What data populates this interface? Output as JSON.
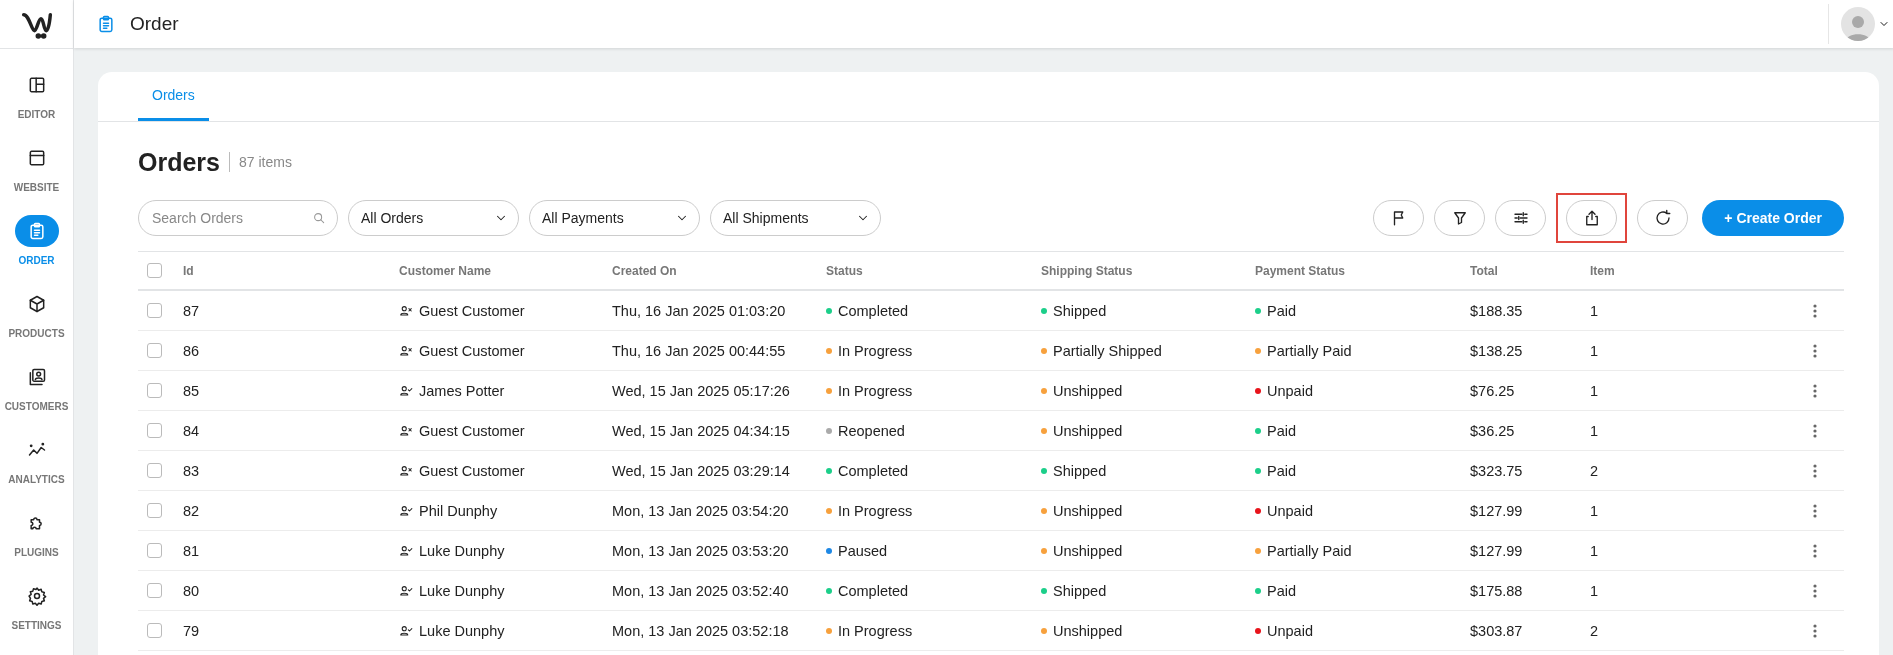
{
  "sidebar": {
    "items": [
      {
        "label": "EDITOR",
        "selected": false
      },
      {
        "label": "WEBSITE",
        "selected": false
      },
      {
        "label": "ORDER",
        "selected": true
      },
      {
        "label": "PRODUCTS",
        "selected": false
      },
      {
        "label": "CUSTOMERS",
        "selected": false
      },
      {
        "label": "ANALYTICS",
        "selected": false
      },
      {
        "label": "PLUGINS",
        "selected": false
      },
      {
        "label": "SETTINGS",
        "selected": false
      }
    ]
  },
  "header": {
    "title": "Order"
  },
  "tabs": [
    {
      "label": "Orders",
      "selected": true
    }
  ],
  "page": {
    "title": "Orders",
    "count": "87 items"
  },
  "search": {
    "placeholder": "Search Orders"
  },
  "filters": [
    {
      "value": "All Orders"
    },
    {
      "value": "All Payments"
    },
    {
      "value": "All Shipments"
    }
  ],
  "toolbar_buttons": [
    {
      "kind": "flag",
      "highlighted": false
    },
    {
      "kind": "filter",
      "highlighted": false
    },
    {
      "kind": "sliders",
      "highlighted": false
    },
    {
      "kind": "export",
      "highlighted": true
    },
    {
      "kind": "refresh",
      "highlighted": false
    }
  ],
  "create_button": "+ Create Order",
  "table": {
    "columns": [
      "Id",
      "Customer Name",
      "Created On",
      "Status",
      "Shipping Status",
      "Payment Status",
      "Total",
      "Item"
    ],
    "header_checked": false,
    "rows": [
      {
        "checked": false,
        "id": "87",
        "customer": "Guest Customer",
        "kind": "guest",
        "created": "Thu, 16 Jan 2025 01:03:20",
        "status": {
          "text": "Completed",
          "color": "#1ccf8a"
        },
        "shipping": {
          "text": "Shipped",
          "color": "#1ccf8a"
        },
        "payment": {
          "text": "Paid",
          "color": "#1ccf8a"
        },
        "total": "$188.35",
        "item": "1"
      },
      {
        "checked": false,
        "id": "86",
        "customer": "Guest Customer",
        "kind": "guest",
        "created": "Thu, 16 Jan 2025 00:44:55",
        "status": {
          "text": "In Progress",
          "color": "#f7a13d"
        },
        "shipping": {
          "text": "Partially Shipped",
          "color": "#f7a13d"
        },
        "payment": {
          "text": "Partially Paid",
          "color": "#f7a13d"
        },
        "total": "$138.25",
        "item": "1"
      },
      {
        "checked": false,
        "id": "85",
        "customer": "James Potter",
        "kind": "registered",
        "created": "Wed, 15 Jan 2025 05:17:26",
        "status": {
          "text": "In Progress",
          "color": "#f7a13d"
        },
        "shipping": {
          "text": "Unshipped",
          "color": "#f7a13d"
        },
        "payment": {
          "text": "Unpaid",
          "color": "#e8141b"
        },
        "total": "$76.25",
        "item": "1"
      },
      {
        "checked": false,
        "id": "84",
        "customer": "Guest Customer",
        "kind": "guest",
        "created": "Wed, 15 Jan 2025 04:34:15",
        "status": {
          "text": "Reopened",
          "color": "#aaaaaa"
        },
        "shipping": {
          "text": "Unshipped",
          "color": "#f7a13d"
        },
        "payment": {
          "text": "Paid",
          "color": "#1ccf8a"
        },
        "total": "$36.25",
        "item": "1"
      },
      {
        "checked": false,
        "id": "83",
        "customer": "Guest Customer",
        "kind": "guest",
        "created": "Wed, 15 Jan 2025 03:29:14",
        "status": {
          "text": "Completed",
          "color": "#1ccf8a"
        },
        "shipping": {
          "text": "Shipped",
          "color": "#1ccf8a"
        },
        "payment": {
          "text": "Paid",
          "color": "#1ccf8a"
        },
        "total": "$323.75",
        "item": "2"
      },
      {
        "checked": false,
        "id": "82",
        "customer": "Phil Dunphy",
        "kind": "registered",
        "created": "Mon, 13 Jan 2025 03:54:20",
        "status": {
          "text": "In Progress",
          "color": "#f7a13d"
        },
        "shipping": {
          "text": "Unshipped",
          "color": "#f7a13d"
        },
        "payment": {
          "text": "Unpaid",
          "color": "#e8141b"
        },
        "total": "$127.99",
        "item": "1"
      },
      {
        "checked": false,
        "id": "81",
        "customer": "Luke Dunphy",
        "kind": "registered",
        "created": "Mon, 13 Jan 2025 03:53:20",
        "status": {
          "text": "Paused",
          "color": "#1e88e5"
        },
        "shipping": {
          "text": "Unshipped",
          "color": "#f7a13d"
        },
        "payment": {
          "text": "Partially Paid",
          "color": "#f7a13d"
        },
        "total": "$127.99",
        "item": "1"
      },
      {
        "checked": false,
        "id": "80",
        "customer": "Luke Dunphy",
        "kind": "registered",
        "created": "Mon, 13 Jan 2025 03:52:40",
        "status": {
          "text": "Completed",
          "color": "#1ccf8a"
        },
        "shipping": {
          "text": "Shipped",
          "color": "#1ccf8a"
        },
        "payment": {
          "text": "Paid",
          "color": "#1ccf8a"
        },
        "total": "$175.88",
        "item": "1"
      },
      {
        "checked": false,
        "id": "79",
        "customer": "Luke Dunphy",
        "kind": "registered",
        "created": "Mon, 13 Jan 2025 03:52:18",
        "status": {
          "text": "In Progress",
          "color": "#f7a13d"
        },
        "shipping": {
          "text": "Unshipped",
          "color": "#f7a13d"
        },
        "payment": {
          "text": "Unpaid",
          "color": "#e8141b"
        },
        "total": "$303.87",
        "item": "2"
      }
    ]
  }
}
